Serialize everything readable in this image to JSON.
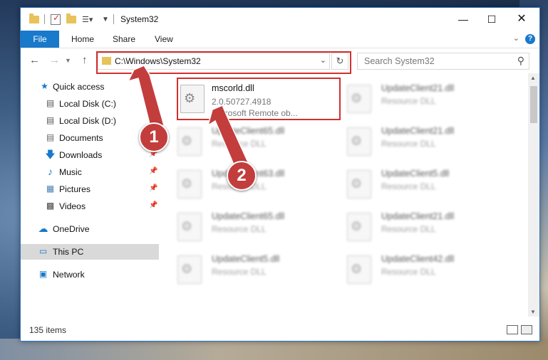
{
  "window": {
    "title": "System32"
  },
  "ribbon": {
    "tabs": [
      "File",
      "Home",
      "Share",
      "View"
    ]
  },
  "address": {
    "path": "C:\\Windows\\System32"
  },
  "search": {
    "placeholder": "Search System32"
  },
  "sidebar": {
    "items": [
      {
        "label": "Quick access",
        "icon": "star-icon",
        "pinned": false
      },
      {
        "label": "Local Disk (C:)",
        "icon": "drive-icon",
        "pinned": true
      },
      {
        "label": "Local Disk (D:)",
        "icon": "drive-icon",
        "pinned": true
      },
      {
        "label": "Documents",
        "icon": "documents-icon",
        "pinned": true
      },
      {
        "label": "Downloads",
        "icon": "download-icon",
        "pinned": true
      },
      {
        "label": "Music",
        "icon": "music-icon",
        "pinned": true
      },
      {
        "label": "Pictures",
        "icon": "pictures-icon",
        "pinned": true
      },
      {
        "label": "Videos",
        "icon": "videos-icon",
        "pinned": true
      },
      {
        "label": "OneDrive",
        "icon": "cloud-icon",
        "pinned": false
      },
      {
        "label": "This PC",
        "icon": "computer-icon",
        "pinned": false,
        "selected": true
      },
      {
        "label": "Network",
        "icon": "network-icon",
        "pinned": false
      }
    ]
  },
  "files": {
    "highlighted": {
      "name": "mscorld.dll",
      "version": "2.0.50727.4918",
      "description": "Microsoft Remote ob..."
    },
    "others": [
      {
        "name": "UpdateClient21.dll",
        "type": "Resource DLL"
      },
      {
        "name": "UpdateClient65.dll",
        "type": "Resource DLL"
      },
      {
        "name": "UpdateClient21.dll",
        "type": "Resource DLL"
      },
      {
        "name": "UpdateClient63.dll",
        "type": "Resource DLL"
      },
      {
        "name": "UpdateClient5.dll",
        "type": "Resource DLL"
      },
      {
        "name": "UpdateClient65.dll",
        "type": "Resource DLL"
      },
      {
        "name": "UpdateClient21.dll",
        "type": "Resource DLL"
      },
      {
        "name": "UpdateClient5.dll",
        "type": "Resource DLL"
      },
      {
        "name": "UpdateClient42.dll",
        "type": "Resource DLL"
      }
    ]
  },
  "status": {
    "count": "135 items"
  },
  "callouts": [
    "1",
    "2"
  ],
  "colors": {
    "accent": "#1979ca",
    "highlight": "#d32f2f",
    "callout": "#c33d3d"
  }
}
